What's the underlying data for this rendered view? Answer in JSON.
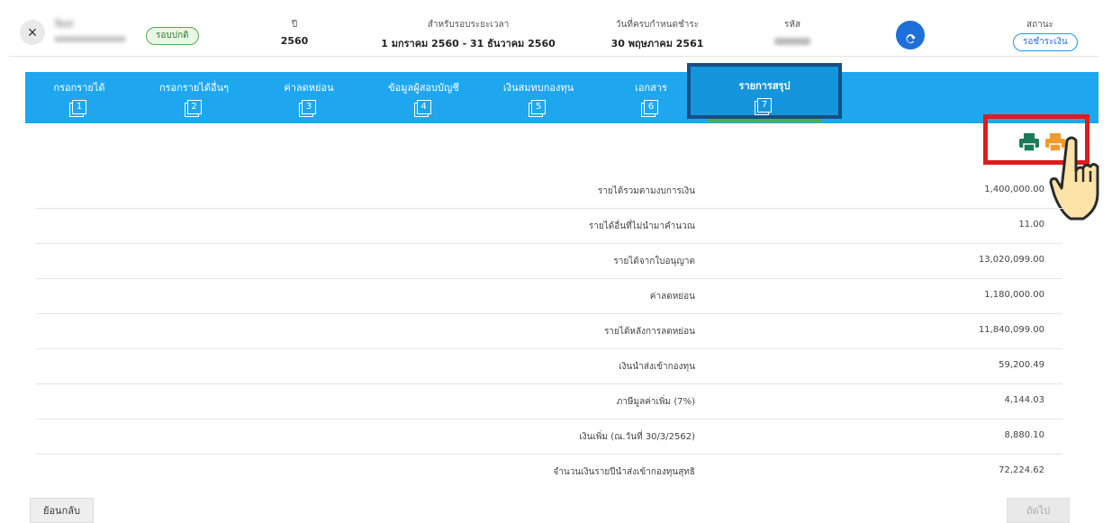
{
  "header": {
    "close_label": "×",
    "user_name": "Test",
    "badge_normal": "รอบปกติ",
    "year_label": "ปี",
    "year_value": "2560",
    "period_label": "สำหรับรอบระยะเวลา",
    "period_value": "1 มกราคม 2560 - 31 ธันวาคม 2560",
    "due_label": "วันที่ครบกำหนดชำระ",
    "due_value": "30 พฤษภาคม 2561",
    "code_label": "รหัส",
    "status_label": "สถานะ",
    "status_value": "รอชำระเงิน"
  },
  "tabs": [
    {
      "label": "กรอกรายได้",
      "num": "1"
    },
    {
      "label": "กรอกรายได้อื่นๆ",
      "num": "2"
    },
    {
      "label": "ค่าลดหย่อน",
      "num": "3"
    },
    {
      "label": "ข้อมูลผู้สอบบัญชี",
      "num": "4"
    },
    {
      "label": "เงินสมทบกองทุน",
      "num": "5"
    },
    {
      "label": "เอกสาร",
      "num": "6"
    },
    {
      "label": "รายการสรุป",
      "num": "7"
    }
  ],
  "summary": [
    {
      "label": "รายได้รวมตามงบการเงิน",
      "value": "1,400,000.00"
    },
    {
      "label": "รายได้อื่นที่ไม่นำมาคำนวณ",
      "value": "11.00"
    },
    {
      "label": "รายได้จากใบอนุญาต",
      "value": "13,020,099.00"
    },
    {
      "label": "ค่าลดหย่อน",
      "value": "1,180,000.00"
    },
    {
      "label": "รายได้หลังการลดหย่อน",
      "value": "11,840,099.00"
    },
    {
      "label": "เงินนำส่งเข้ากองทุน",
      "value": "59,200.49"
    },
    {
      "label": "ภาษีมูลค่าเพิ่ม (7%)",
      "value": "4,144.03"
    },
    {
      "label": "เงินเพิ่ม (ณ.วันที่ 30/3/2562)",
      "value": "8,880.10"
    },
    {
      "label": "จำนวนเงินรายปีนำส่งเข้ากองทุนสุทธิ",
      "value": "72,224.62"
    }
  ],
  "footer": {
    "back_label": "ย้อนกลับ",
    "next_label": "ถัดไป"
  },
  "colors": {
    "tab_bar": "#1ea7ef",
    "print_green": "#1b7a5a",
    "print_orange": "#f29a2e",
    "highlight_red": "#e01b1b"
  }
}
